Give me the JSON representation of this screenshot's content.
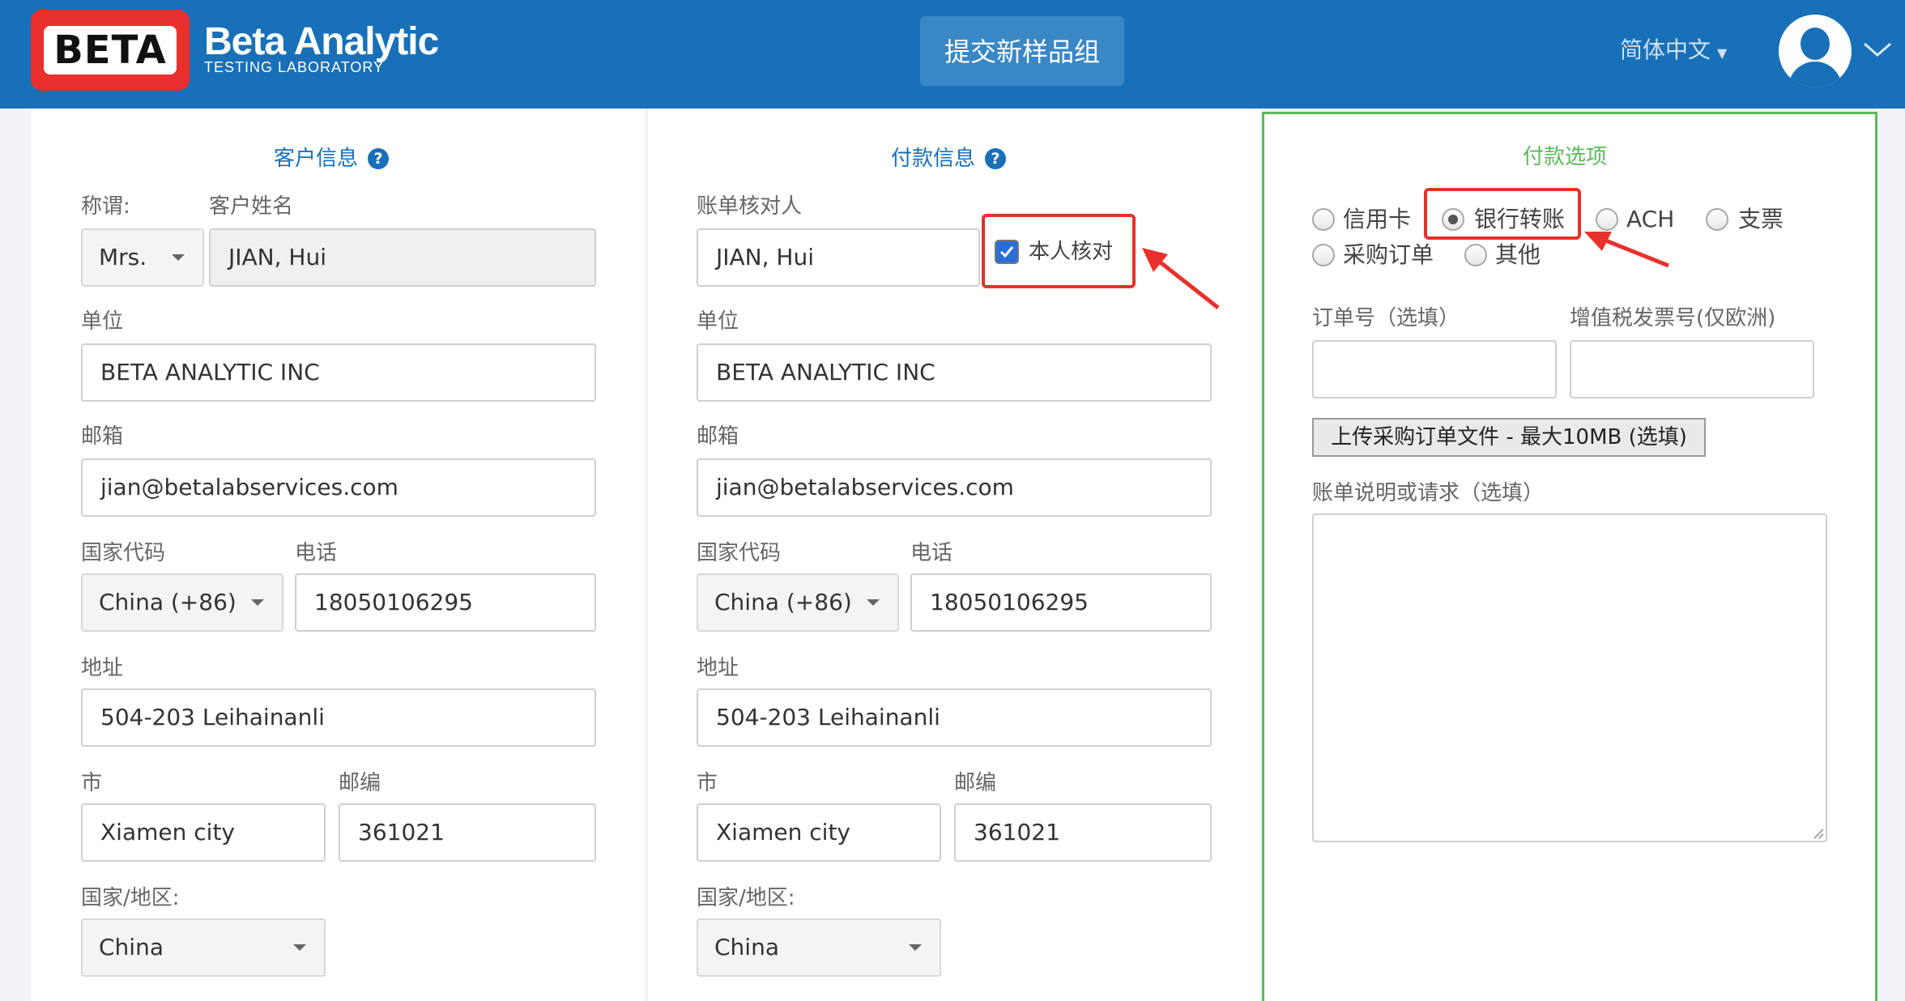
{
  "header": {
    "logo_text": "BETA",
    "brand_name": "Beta Analytic",
    "brand_sub": "TESTING LABORATORY",
    "submit_label": "提交新样品组",
    "language": "简体中文"
  },
  "customer": {
    "title": "客户信息",
    "salutation_label": "称谓:",
    "salutation_value": "Mrs.",
    "name_label": "客户姓名",
    "name_value": "JIAN, Hui",
    "org_label": "单位",
    "org_value": "BETA ANALYTIC INC",
    "email_label": "邮箱",
    "email_value": "jian@betalabservices.com",
    "country_code_label": "国家代码",
    "country_code_value": "China (+86)",
    "phone_label": "电话",
    "phone_value": "18050106295",
    "address_label": "地址",
    "address_value": "504-203 Leihainanli",
    "city_label": "市",
    "city_value": "Xiamen city",
    "zip_label": "邮编",
    "zip_value": "361021",
    "country_label": "国家/地区:",
    "country_value": "China"
  },
  "payment": {
    "title": "付款信息",
    "reviewer_label": "账单核对人",
    "reviewer_value": "JIAN, Hui",
    "self_check_label": "本人核对",
    "self_check_checked": true,
    "org_label": "单位",
    "org_value": "BETA ANALYTIC INC",
    "email_label": "邮箱",
    "email_value": "jian@betalabservices.com",
    "country_code_label": "国家代码",
    "country_code_value": "China (+86)",
    "phone_label": "电话",
    "phone_value": "18050106295",
    "address_label": "地址",
    "address_value": "504-203 Leihainanli",
    "city_label": "市",
    "city_value": "Xiamen city",
    "zip_label": "邮编",
    "zip_value": "361021",
    "country_label": "国家/地区:",
    "country_value": "China"
  },
  "options": {
    "title": "付款选项",
    "methods": [
      "信用卡",
      "银行转账",
      "ACH",
      "支票",
      "采购订单",
      "其他"
    ],
    "selected": "银行转账",
    "po_label": "订单号（选填）",
    "vat_label": "增值税发票号(仅欧洲)",
    "upload_label": "上传采购订单文件 - 最大10MB (选填)",
    "notes_label": "账单说明或请求（选填）"
  },
  "colors": {
    "header_bg": "#1870b8",
    "accent_blue": "#1a6fb8",
    "options_green": "#5cb85c",
    "annotation_red": "#e8302c"
  }
}
